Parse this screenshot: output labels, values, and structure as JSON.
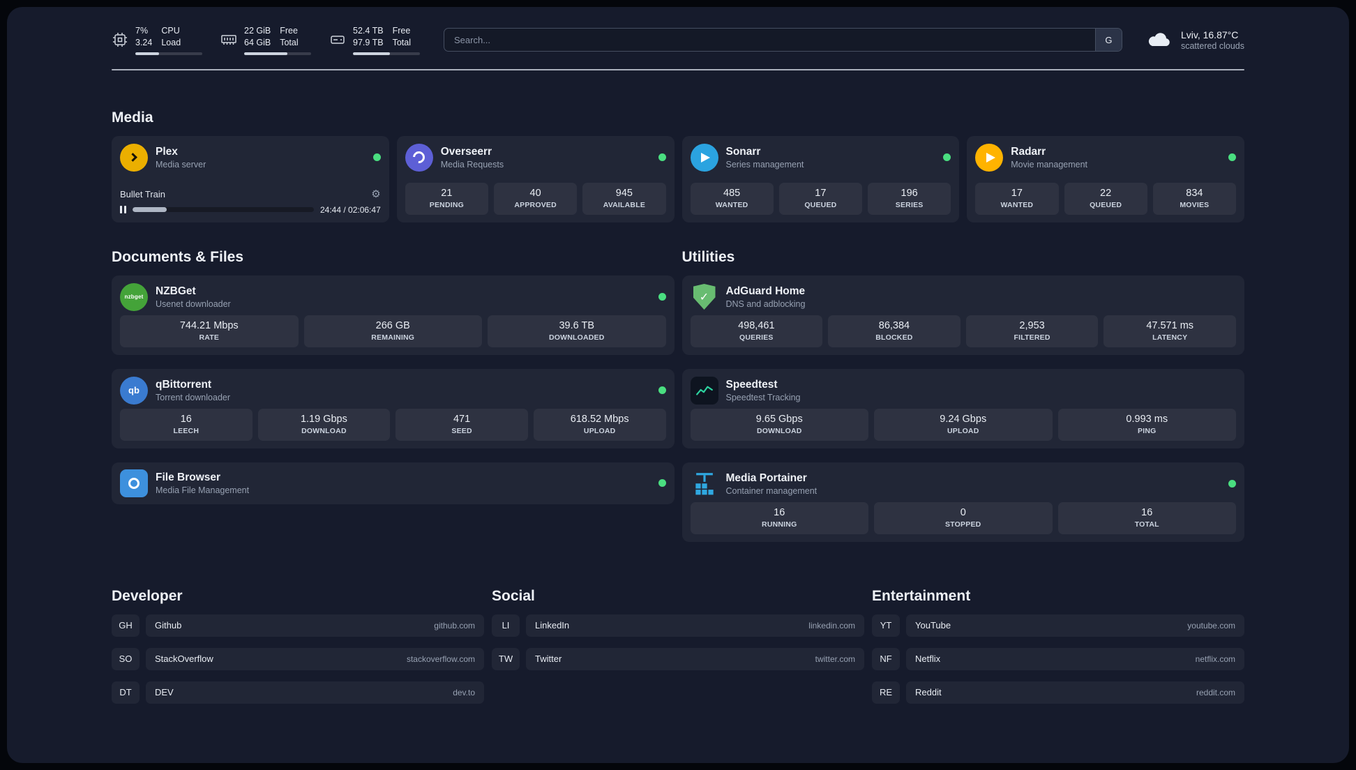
{
  "topbar": {
    "cpu": {
      "value_top": "7%",
      "value_bottom": "3.24",
      "label_top": "CPU",
      "label_bottom": "Load"
    },
    "memory": {
      "value_top": "22 GiB",
      "value_bottom": "64 GiB",
      "label_top": "Free",
      "label_bottom": "Total"
    },
    "disk": {
      "value_top": "52.4 TB",
      "value_bottom": "97.9 TB",
      "label_top": "Free",
      "label_bottom": "Total"
    },
    "search": {
      "placeholder": "Search...",
      "button_label": "G"
    },
    "weather": {
      "location": "Lviv, 16.87°C",
      "condition": "scattered clouds"
    }
  },
  "bars": {
    "cpu": "35%",
    "memory": "65%",
    "disk": "55%",
    "plex": "19%"
  },
  "sections": {
    "media": {
      "title": "Media"
    },
    "documents": {
      "title": "Documents & Files"
    },
    "utilities": {
      "title": "Utilities"
    },
    "developer": {
      "title": "Developer"
    },
    "social": {
      "title": "Social"
    },
    "entertainment": {
      "title": "Entertainment"
    }
  },
  "services": {
    "plex": {
      "name": "Plex",
      "subtitle": "Media server",
      "player": {
        "title": "Bullet Train",
        "time": "24:44 / 02:06:47"
      }
    },
    "overseerr": {
      "name": "Overseerr",
      "subtitle": "Media Requests",
      "stats": [
        {
          "value": "21",
          "label": "PENDING"
        },
        {
          "value": "40",
          "label": "APPROVED"
        },
        {
          "value": "945",
          "label": "AVAILABLE"
        }
      ]
    },
    "sonarr": {
      "name": "Sonarr",
      "subtitle": "Series management",
      "stats": [
        {
          "value": "485",
          "label": "WANTED"
        },
        {
          "value": "17",
          "label": "QUEUED"
        },
        {
          "value": "196",
          "label": "SERIES"
        }
      ]
    },
    "radarr": {
      "name": "Radarr",
      "subtitle": "Movie management",
      "stats": [
        {
          "value": "17",
          "label": "WANTED"
        },
        {
          "value": "22",
          "label": "QUEUED"
        },
        {
          "value": "834",
          "label": "MOVIES"
        }
      ]
    },
    "nzbget": {
      "name": "NZBGet",
      "subtitle": "Usenet downloader",
      "icon_text": "nzbget",
      "stats": [
        {
          "value": "744.21 Mbps",
          "label": "RATE"
        },
        {
          "value": "266 GB",
          "label": "REMAINING"
        },
        {
          "value": "39.6 TB",
          "label": "DOWNLOADED"
        }
      ]
    },
    "qbittorrent": {
      "name": "qBittorrent",
      "subtitle": "Torrent downloader",
      "icon_text": "qb",
      "stats": [
        {
          "value": "16",
          "label": "LEECH"
        },
        {
          "value": "1.19 Gbps",
          "label": "DOWNLOAD"
        },
        {
          "value": "471",
          "label": "SEED"
        },
        {
          "value": "618.52 Mbps",
          "label": "UPLOAD"
        }
      ]
    },
    "filebrowser": {
      "name": "File Browser",
      "subtitle": "Media File Management"
    },
    "adguard": {
      "name": "AdGuard Home",
      "subtitle": "DNS and adblocking",
      "shield_check": "✓",
      "stats": [
        {
          "value": "498,461",
          "label": "QUERIES"
        },
        {
          "value": "86,384",
          "label": "BLOCKED"
        },
        {
          "value": "2,953",
          "label": "FILTERED"
        },
        {
          "value": "47.571 ms",
          "label": "LATENCY"
        }
      ]
    },
    "speedtest": {
      "name": "Speedtest",
      "subtitle": "Speedtest Tracking",
      "stats": [
        {
          "value": "9.65 Gbps",
          "label": "DOWNLOAD"
        },
        {
          "value": "9.24 Gbps",
          "label": "UPLOAD"
        },
        {
          "value": "0.993 ms",
          "label": "PING"
        }
      ]
    },
    "portainer": {
      "name": "Media Portainer",
      "subtitle": "Container management",
      "stats": [
        {
          "value": "16",
          "label": "RUNNING"
        },
        {
          "value": "0",
          "label": "STOPPED"
        },
        {
          "value": "16",
          "label": "TOTAL"
        }
      ]
    }
  },
  "bookmarks": {
    "developer": [
      {
        "abbr": "GH",
        "name": "Github",
        "url": "github.com"
      },
      {
        "abbr": "SO",
        "name": "StackOverflow",
        "url": "stackoverflow.com"
      },
      {
        "abbr": "DT",
        "name": "DEV",
        "url": "dev.to"
      }
    ],
    "social": [
      {
        "abbr": "LI",
        "name": "LinkedIn",
        "url": "linkedin.com"
      },
      {
        "abbr": "TW",
        "name": "Twitter",
        "url": "twitter.com"
      }
    ],
    "entertainment": [
      {
        "abbr": "YT",
        "name": "YouTube",
        "url": "youtube.com"
      },
      {
        "abbr": "NF",
        "name": "Netflix",
        "url": "netflix.com"
      },
      {
        "abbr": "RE",
        "name": "Reddit",
        "url": "reddit.com"
      }
    ]
  },
  "colors": {
    "status_online": "#4ade80",
    "plex": "#ebaf00",
    "overseerr": "#5d5fd6",
    "sonarr": "#2ba3e0",
    "radarr": "#ffb300",
    "nzbget": "#44a339",
    "qbittorrent": "#3a7bd0",
    "filebrowser": "#3d90dd",
    "adguard": "#68bc71",
    "speedtest_bg": "#0e1420",
    "speedtest_line": "#2dd4a0",
    "portainer": "#2fa8e1"
  }
}
